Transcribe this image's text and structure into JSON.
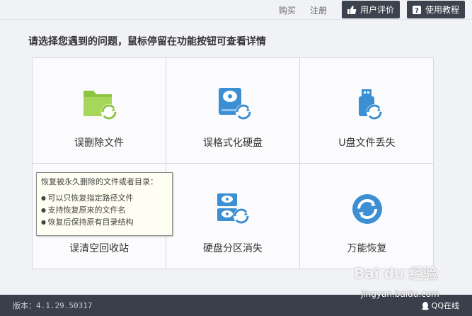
{
  "topbar": {
    "buy": "购买",
    "register": "注册",
    "review_button": "用户评价",
    "tutorial_button": "使用教程"
  },
  "prompt": "请选择您遇到的问题，鼠标停留在功能按钮可查看详情",
  "options": [
    {
      "label": "误删除文件",
      "icon": "folder-recover-icon"
    },
    {
      "label": "误格式化硬盘",
      "icon": "hdd-recover-icon"
    },
    {
      "label": "U盘文件丢失",
      "icon": "usb-recover-icon"
    },
    {
      "label": "误清空回收站",
      "icon": "recycle-bin-icon"
    },
    {
      "label": "硬盘分区消失",
      "icon": "partition-recover-icon"
    },
    {
      "label": "万能恢复",
      "icon": "universal-recover-icon"
    }
  ],
  "tooltip": {
    "title": "恢复被永久删除的文件或者目录：",
    "items": [
      "可以只恢复指定路径文件",
      "支持恢复原来的文件名",
      "恢复后保持原有目录结构"
    ]
  },
  "footer": {
    "version": "版本：4.1.29.50317",
    "qq": "QQ在线"
  },
  "watermark": {
    "brand": "Bai du 经验",
    "url": "jingyan.baidu.com"
  },
  "colors": {
    "accent_blue": "#3d8fd3",
    "accent_green": "#8cc63f",
    "dark_bar": "#3a3f4c"
  }
}
